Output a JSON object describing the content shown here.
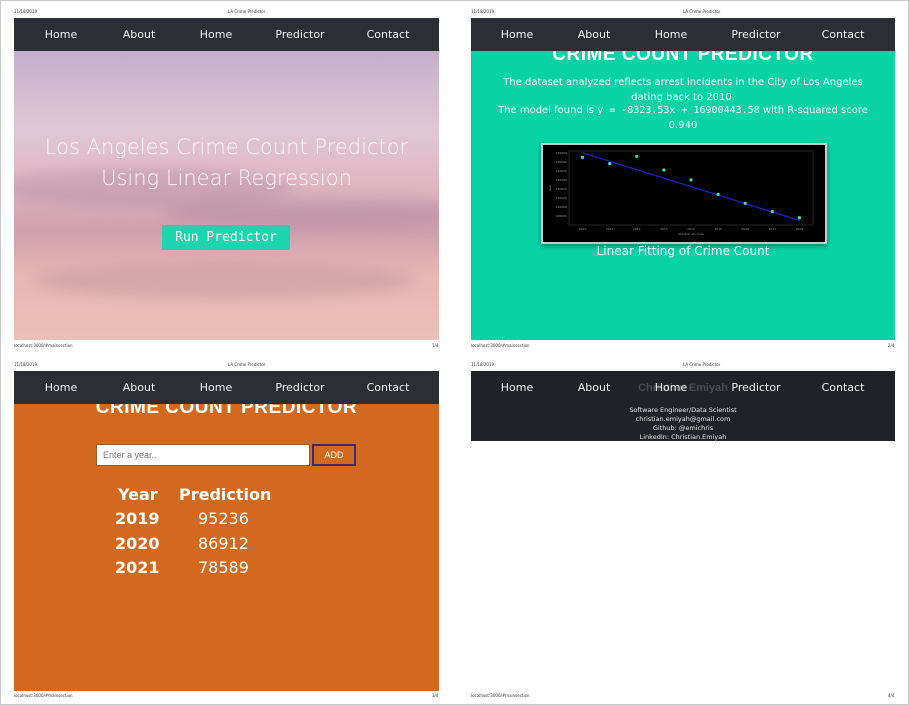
{
  "pages": [
    {
      "date": "11/18/2019",
      "title": "LA Crime Predictor",
      "url": "localhost:3000/#mainsection",
      "page_no": "1/4"
    },
    {
      "date": "11/18/2019",
      "title": "LA Crime Predictor",
      "url": "localhost:3000/#mainsection",
      "page_no": "2/4"
    },
    {
      "date": "11/18/2019",
      "title": "LA Crime Predictor",
      "url": "localhost:3000/#mainsection",
      "page_no": "3/4"
    },
    {
      "date": "11/18/2019",
      "title": "LA Crime Predictor",
      "url": "localhost:3000/#mainsection",
      "page_no": "4/4"
    }
  ],
  "nav": [
    "Home",
    "About",
    "Home",
    "Predictor",
    "Contact"
  ],
  "hero": {
    "title_line1": "Los Angeles Crime Count Predictor",
    "title_line2": "Using Linear Regression",
    "button": "Run Predictor"
  },
  "model": {
    "title": "CRIME COUNT PREDICTOR",
    "desc": "The dataset analyzed reflects arrest incidents in the City of Los Angeles dating back to 2010.",
    "equation_prefix": "The model found is ",
    "equation": "y = -8323.53x + 16900443.58",
    "equation_suffix": " with R-squared score",
    "score": "0.940",
    "caption": "Linear Fitting of Crime Count"
  },
  "predictor": {
    "title": "CRIME COUNT PREDICTOR",
    "input_placeholder": "Enter a year..",
    "add_button": "ADD",
    "col_year": "Year",
    "col_prediction": "Prediction",
    "rows": [
      {
        "year": "2019",
        "value": "95236"
      },
      {
        "year": "2020",
        "value": "86912"
      },
      {
        "year": "2021",
        "value": "78589"
      }
    ]
  },
  "contact": {
    "ghost_name": "Christian Emiyah",
    "role": "Software Engineer/Data Scientist",
    "email": "christian.emiyah@gmail.com",
    "github": "Github: @emichris",
    "linkedin": "LinkedIn: Christian.Emiyah"
  },
  "chart_data": {
    "type": "scatter",
    "title": "",
    "xlabel": "Number of crime",
    "ylabel": "Year",
    "x": [
      2010,
      2011,
      2012,
      2013,
      2014,
      2015,
      2016,
      2017,
      2018
    ],
    "y": [
      165000,
      158000,
      166000,
      151000,
      140000,
      124000,
      114000,
      105000,
      98000
    ],
    "fit_line": {
      "x": [
        2010,
        2018
      ],
      "y": [
        170000,
        95000
      ]
    },
    "xlim": [
      2009.5,
      2018.5
    ],
    "ylim": [
      90000,
      172000
    ],
    "x_ticks": [
      "2010",
      "2011",
      "2012",
      "2013",
      "2014",
      "2015",
      "2016",
      "2017",
      "2018"
    ],
    "y_ticks": [
      "100000",
      "110000",
      "120000",
      "130000",
      "140000",
      "150000",
      "160000",
      "170000"
    ],
    "colors": {
      "points": "#2ee6b5",
      "line": "#1a22c8",
      "background": "#000000",
      "text": "#9a9a9a"
    }
  }
}
